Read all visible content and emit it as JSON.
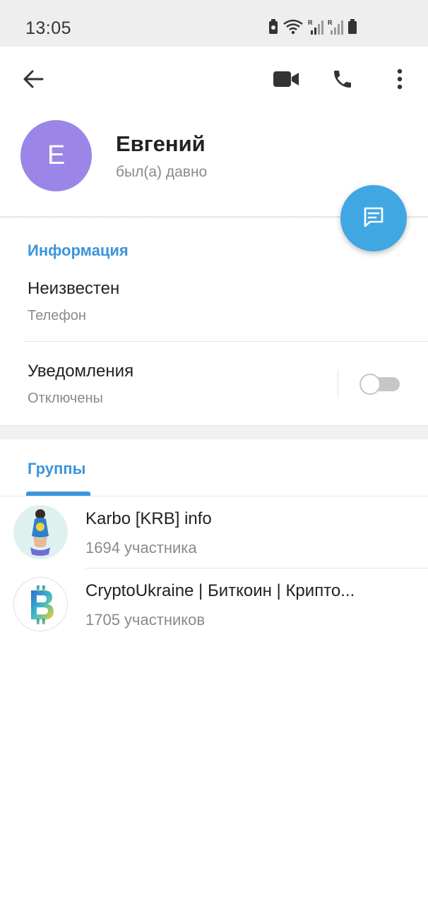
{
  "status_bar": {
    "time": "13:05",
    "icons": [
      "battery-saver-icon",
      "wifi-icon",
      "signal-icon",
      "signal-icon",
      "battery-icon"
    ]
  },
  "toolbar": {
    "icons": [
      "back-arrow-icon",
      "video-camera-icon",
      "phone-icon",
      "more-vert-icon"
    ]
  },
  "profile": {
    "avatar_letter": "Е",
    "avatar_color": "#9b86e8",
    "name": "Евгений",
    "status": "был(а) давно"
  },
  "info": {
    "title": "Информация",
    "phone_value": "Неизвестен",
    "phone_label": "Телефон",
    "notifications_value": "Уведомления",
    "notifications_label": "Отключены",
    "notifications_enabled": false
  },
  "groups": {
    "title": "Группы",
    "items": [
      {
        "name": "Karbo [KRB] info",
        "members": "1694 участника"
      },
      {
        "name": "CryptoUkraine | Биткоин | Крипто...",
        "members": "1705 участников"
      }
    ]
  },
  "colors": {
    "accent": "#3a95dd",
    "fab": "#40a7e3"
  }
}
